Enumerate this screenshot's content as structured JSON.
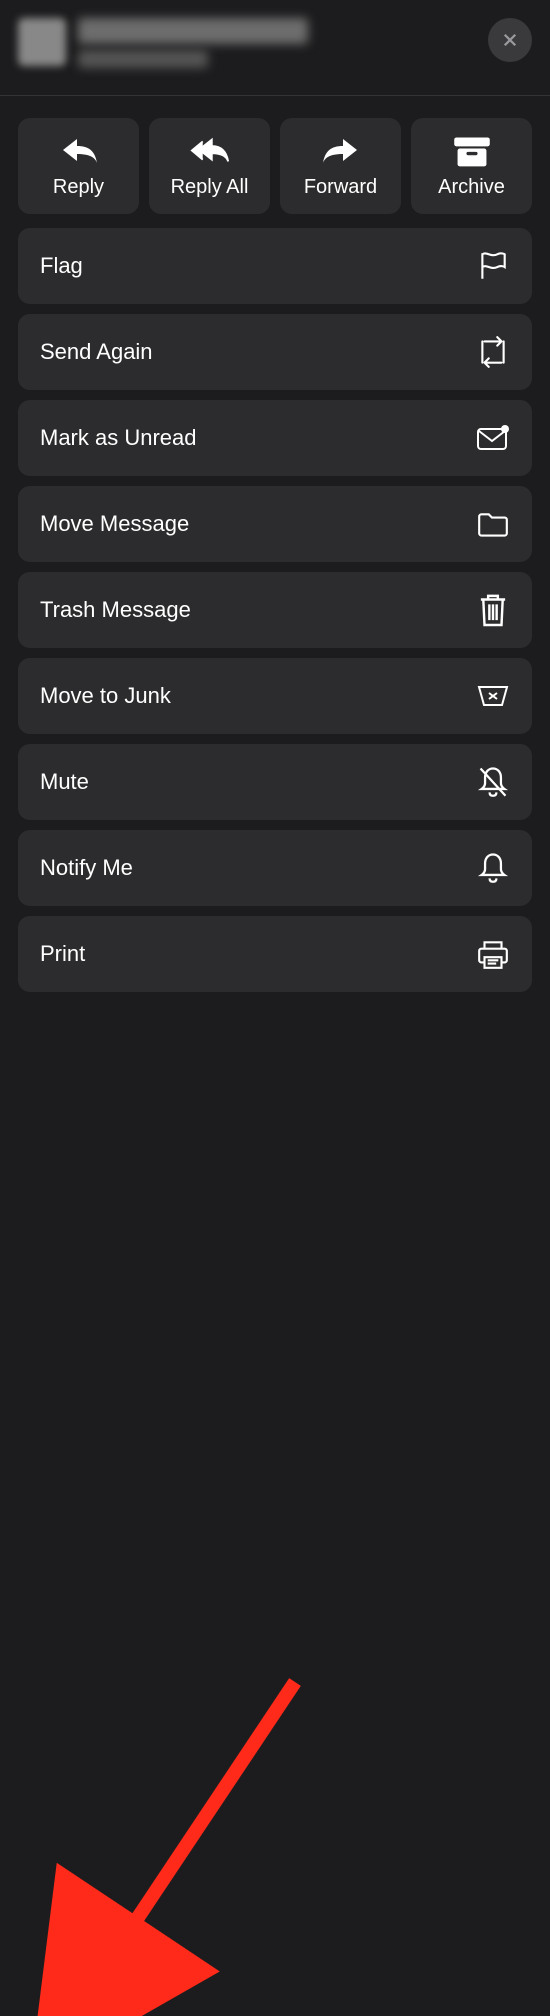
{
  "actions": {
    "reply": {
      "label": "Reply"
    },
    "replyAll": {
      "label": "Reply All"
    },
    "forward": {
      "label": "Forward"
    },
    "archive": {
      "label": "Archive"
    }
  },
  "menu": {
    "flag": {
      "label": "Flag"
    },
    "sendAgain": {
      "label": "Send Again"
    },
    "markUnread": {
      "label": "Mark as Unread"
    },
    "moveMsg": {
      "label": "Move Message"
    },
    "trashMsg": {
      "label": "Trash Message"
    },
    "moveJunk": {
      "label": "Move to Junk"
    },
    "mute": {
      "label": "Mute"
    },
    "notify": {
      "label": "Notify Me"
    },
    "print": {
      "label": "Print"
    }
  },
  "annotation": {
    "arrow_color": "#ff2a1a",
    "arrow_target": "print"
  }
}
